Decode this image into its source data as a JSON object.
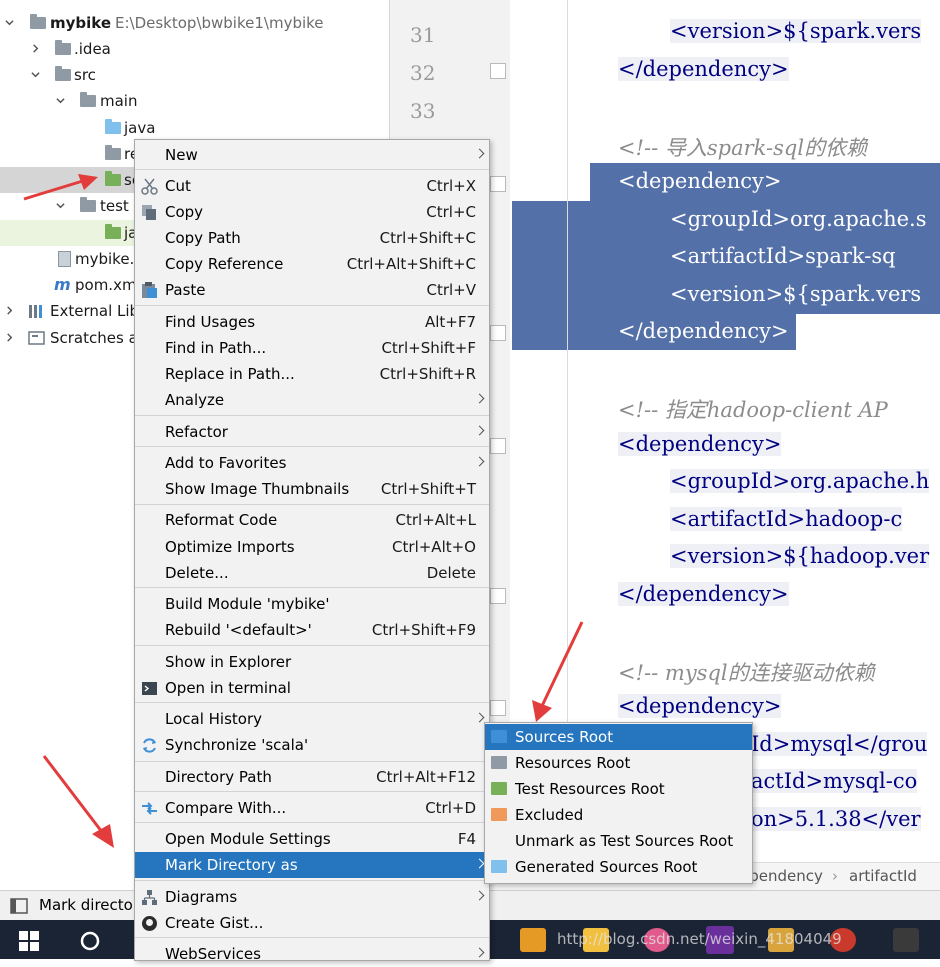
{
  "project_tree": {
    "items": [
      {
        "label": "mybike",
        "path": "E:\\Desktop\\bwbike1\\mybike",
        "icon": "module-folder-icon"
      },
      {
        "label": ".idea",
        "icon": "folder-icon"
      },
      {
        "label": "src",
        "icon": "folder-icon"
      },
      {
        "label": "main",
        "icon": "folder-icon"
      },
      {
        "label": "java",
        "icon": "source-folder-icon"
      },
      {
        "label": "re",
        "icon": "resources-folder-icon"
      },
      {
        "label": "sc",
        "icon": "scala-folder-icon"
      },
      {
        "label": "test",
        "icon": "folder-icon"
      },
      {
        "label": "ja",
        "icon": "test-source-folder-icon"
      },
      {
        "label": "mybike.i",
        "icon": "iml-file-icon"
      },
      {
        "label": "pom.xm",
        "icon": "maven-file-icon"
      },
      {
        "label": "External Lib",
        "icon": "libraries-icon"
      },
      {
        "label": "Scratches an",
        "icon": "scratches-icon"
      }
    ]
  },
  "editor": {
    "line_numbers": [
      "31",
      "32",
      "33"
    ],
    "lines": [
      {
        "indent": 2,
        "kind": "tag",
        "text": "<version>${spark.vers"
      },
      {
        "indent": 1,
        "kind": "tag",
        "text": "</dependency>"
      },
      {
        "indent": 1,
        "kind": "comment",
        "text": "<!-- 导入spark-sql的依赖"
      },
      {
        "indent": 1,
        "kind": "tag",
        "text": "<dependency>"
      },
      {
        "indent": 2,
        "kind": "tag",
        "text": "<groupId>org.apache.s"
      },
      {
        "indent": 2,
        "kind": "tag",
        "text": "<artifactId>spark-sq"
      },
      {
        "indent": 2,
        "kind": "tag",
        "text": "<version>${spark.vers"
      },
      {
        "indent": 1,
        "kind": "tag",
        "text": "</dependency>"
      },
      {
        "indent": 1,
        "kind": "comment",
        "text": "<!-- 指定hadoop-client AP"
      },
      {
        "indent": 1,
        "kind": "tag",
        "text": "<dependency>"
      },
      {
        "indent": 2,
        "kind": "tag",
        "text": "<groupId>org.apache.h"
      },
      {
        "indent": 2,
        "kind": "tag",
        "text": "<artifactId>hadoop-c"
      },
      {
        "indent": 2,
        "kind": "tag",
        "text": "<version>${hadoop.ver"
      },
      {
        "indent": 1,
        "kind": "tag",
        "text": "</dependency>"
      },
      {
        "indent": 1,
        "kind": "comment",
        "text": "<!-- mysql的连接驱动依赖 "
      },
      {
        "indent": 1,
        "kind": "tag",
        "text": "<dependency>"
      },
      {
        "indent": 2,
        "kind": "tag",
        "text": "Id>mysql</grou"
      },
      {
        "indent": 2,
        "kind": "tag",
        "text": "actId>mysql-co"
      },
      {
        "indent": 2,
        "kind": "tag",
        "text": "on>5.1.38</ver"
      }
    ],
    "breadcrumb": [
      "ependency",
      "artifactId"
    ]
  },
  "context_menu": {
    "items": [
      {
        "label": "New",
        "shortcut": "",
        "submenu": true,
        "icon": ""
      },
      {
        "label": "Cut",
        "shortcut": "Ctrl+X",
        "icon": "scissors-icon"
      },
      {
        "label": "Copy",
        "shortcut": "Ctrl+C",
        "icon": "copy-icon"
      },
      {
        "label": "Copy Path",
        "shortcut": "Ctrl+Shift+C",
        "icon": ""
      },
      {
        "label": "Copy Reference",
        "shortcut": "Ctrl+Alt+Shift+C",
        "icon": ""
      },
      {
        "label": "Paste",
        "shortcut": "Ctrl+V",
        "icon": "paste-icon"
      },
      {
        "label": "Find Usages",
        "shortcut": "Alt+F7",
        "icon": ""
      },
      {
        "label": "Find in Path...",
        "shortcut": "Ctrl+Shift+F",
        "icon": ""
      },
      {
        "label": "Replace in Path...",
        "shortcut": "Ctrl+Shift+R",
        "icon": ""
      },
      {
        "label": "Analyze",
        "shortcut": "",
        "submenu": true,
        "icon": ""
      },
      {
        "label": "Refactor",
        "shortcut": "",
        "submenu": true,
        "icon": ""
      },
      {
        "label": "Add to Favorites",
        "shortcut": "",
        "submenu": true,
        "icon": ""
      },
      {
        "label": "Show Image Thumbnails",
        "shortcut": "Ctrl+Shift+T",
        "icon": ""
      },
      {
        "label": "Reformat Code",
        "shortcut": "Ctrl+Alt+L",
        "icon": ""
      },
      {
        "label": "Optimize Imports",
        "shortcut": "Ctrl+Alt+O",
        "icon": ""
      },
      {
        "label": "Delete...",
        "shortcut": "Delete",
        "icon": ""
      },
      {
        "label": "Build Module 'mybike'",
        "shortcut": "",
        "icon": ""
      },
      {
        "label": "Rebuild '<default>'",
        "shortcut": "Ctrl+Shift+F9",
        "icon": ""
      },
      {
        "label": "Show in Explorer",
        "shortcut": "",
        "icon": ""
      },
      {
        "label": "Open in terminal",
        "shortcut": "",
        "icon": "terminal-icon"
      },
      {
        "label": "Local History",
        "shortcut": "",
        "submenu": true,
        "icon": ""
      },
      {
        "label": "Synchronize 'scala'",
        "shortcut": "",
        "icon": "sync-icon"
      },
      {
        "label": "Directory Path",
        "shortcut": "Ctrl+Alt+F12",
        "icon": ""
      },
      {
        "label": "Compare With...",
        "shortcut": "Ctrl+D",
        "icon": "compare-icon"
      },
      {
        "label": "Open Module Settings",
        "shortcut": "F4",
        "icon": ""
      },
      {
        "label": "Mark Directory as",
        "shortcut": "",
        "submenu": true,
        "active": true,
        "icon": ""
      },
      {
        "label": "Diagrams",
        "shortcut": "",
        "submenu": true,
        "icon": "diagrams-icon"
      },
      {
        "label": "Create Gist...",
        "shortcut": "",
        "icon": "github-icon"
      },
      {
        "label": "WebServices",
        "shortcut": "",
        "submenu": true,
        "icon": ""
      }
    ]
  },
  "mark_directory_submenu": {
    "items": [
      {
        "label": "Sources Root",
        "color": "#3d8fd6",
        "active": true
      },
      {
        "label": "Resources Root",
        "color": "#8f9aa5"
      },
      {
        "label": "Test Resources Root",
        "color": "#78b05a"
      },
      {
        "label": "Excluded",
        "color": "#ef9a5b"
      },
      {
        "label": "Unmark as Test Sources Root",
        "color": ""
      },
      {
        "label": "Generated Sources Root",
        "color": "#7fc1ec"
      }
    ]
  },
  "status": {
    "tool_window_label": "Mark directo"
  },
  "taskbar": {
    "watermark": "http://blog.csdn.net/weixin_41804049"
  },
  "colors": {
    "selection": "#5470a8",
    "menu_active": "#2675bf",
    "xml_tag": "#000080",
    "comment": "#8c8c8c"
  }
}
